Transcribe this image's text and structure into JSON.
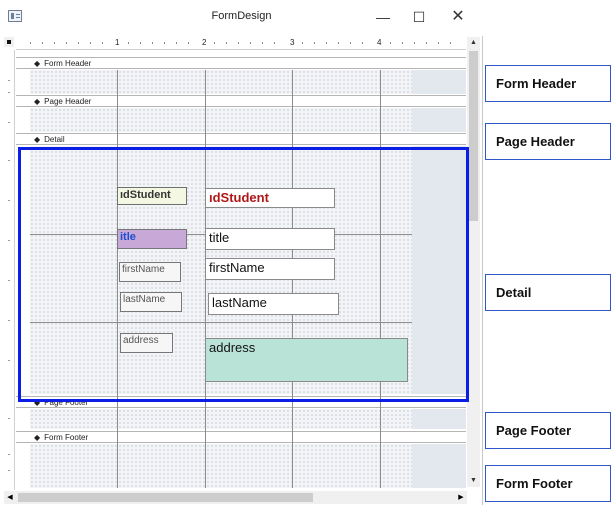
{
  "window": {
    "title": "FormDesign",
    "minimize_glyph": "—",
    "maximize_glyph": "☐",
    "close_glyph": "✕"
  },
  "ruler": {
    "numbers": [
      "1",
      "2",
      "3",
      "4"
    ]
  },
  "sections": {
    "form_header": "Form Header",
    "page_header": "Page Header",
    "detail": "Detail",
    "page_footer": "Page Footer",
    "form_footer": "Form Footer"
  },
  "controls": {
    "id_label": "ıdStudent",
    "id_textbox": "ıdStudent",
    "title_label": "itle",
    "title_textbox": "title",
    "firstname_label": "firstName",
    "firstname_textbox": "firstName",
    "lastname_label": "lastName",
    "lastname_textbox": "lastName",
    "address_label": "address",
    "address_textbox": "address"
  },
  "annotations": {
    "form_header": "Form Header",
    "page_header": "Page Header",
    "detail": "Detail",
    "page_footer": "Page Footer",
    "form_footer": "Form Footer"
  },
  "colors": {
    "selection": "#0a1ee6",
    "id_textbox_text": "#b01818",
    "title_label_bg": "#c8a8d6",
    "title_label_text": "#1a4fd0",
    "address_bg": "#b9e3d6",
    "id_label_bg": "#f4f7e2",
    "callout_border": "#2f58c8"
  },
  "icons": {
    "app": "form-app-icon",
    "section_arrow": "section-arrow-icon"
  },
  "scrollbars": {
    "up": "▲",
    "down": "▼",
    "left": "◀",
    "right": "▶"
  }
}
